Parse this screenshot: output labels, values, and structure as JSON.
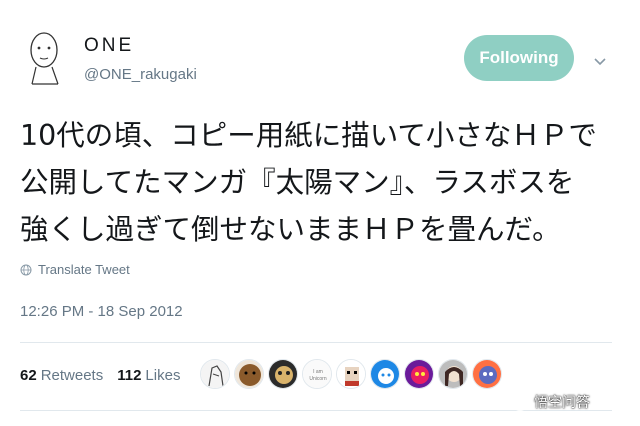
{
  "profile": {
    "display_name": "ONE",
    "handle": "@ONE_rakugaki"
  },
  "follow_button": {
    "label": "Following",
    "color": "#8fcfc3"
  },
  "tweet": {
    "lines": [
      "10代の頃、コピー用紙に描いて小さなＨＰで",
      "公開してたマンガ『太陽マン』、ラスボスを",
      "強くし過ぎて倒せないままＨＰを畳んだ。"
    ]
  },
  "translate": {
    "label": "Translate Tweet"
  },
  "timestamp": "12:26 PM - 18 Sep 2012",
  "stats": {
    "retweets_count": "62",
    "retweets_label": "Retweets",
    "likes_count": "112",
    "likes_label": "Likes"
  },
  "likers": [
    {
      "icon": "sketch-figure-avatar"
    },
    {
      "icon": "brown-face-avatar"
    },
    {
      "icon": "dark-mask-avatar"
    },
    {
      "icon": "i-am-unicorn-avatar",
      "text": "I am\nUnicorn"
    },
    {
      "icon": "pixel-face-avatar"
    },
    {
      "icon": "blue-cartoon-avatar"
    },
    {
      "icon": "purple-face-avatar"
    },
    {
      "icon": "anime-girl-avatar"
    },
    {
      "icon": "anime-character-avatar"
    }
  ],
  "watermark": {
    "label": "悟空问答"
  }
}
